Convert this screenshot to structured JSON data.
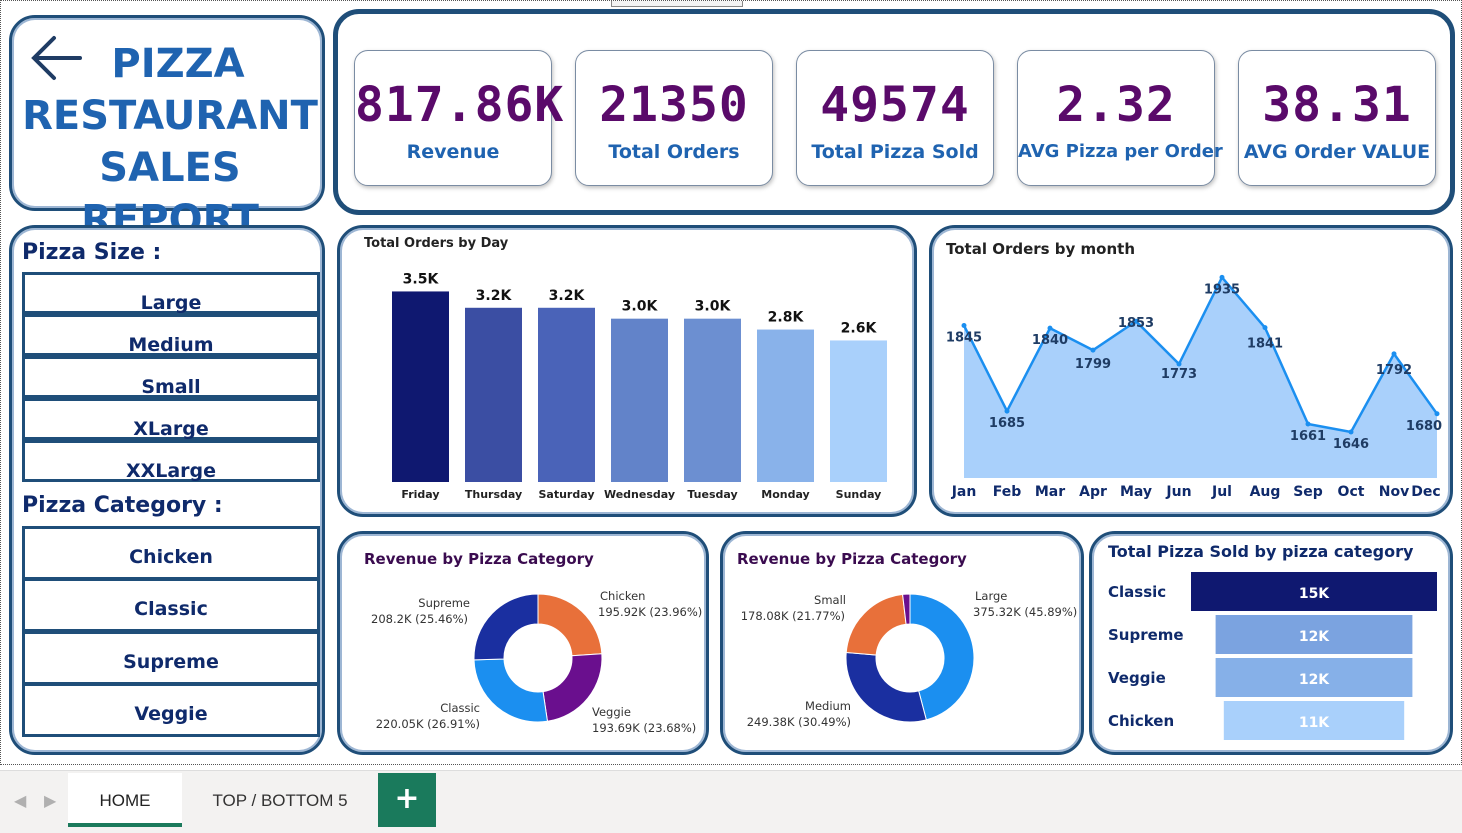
{
  "title": {
    "line1": "PIZZA",
    "line2": "RESTAURANT",
    "line3": "SALES REPORT"
  },
  "kpis": [
    {
      "value": "817.86K",
      "label": "Revenue"
    },
    {
      "value": "21350",
      "label": "Total Orders"
    },
    {
      "value": "49574",
      "label": "Total Pizza Sold"
    },
    {
      "value": "2.32",
      "label": "AVG Pizza per Order"
    },
    {
      "value": "38.31",
      "label": "AVG Order VALUE"
    }
  ],
  "filters": {
    "size_heading": "Pizza Size :",
    "sizes": [
      "Large",
      "Medium",
      "Small",
      "XLarge",
      "XXLarge"
    ],
    "category_heading": "Pizza Category :",
    "categories": [
      "Chicken",
      "Classic",
      "Supreme",
      "Veggie"
    ]
  },
  "colors": {
    "accent": "#1f4e79",
    "kpi_value": "#5a0a6a",
    "kpi_label": "#1f63b0",
    "tab_green": "#1a7a5c"
  },
  "chart_data": [
    {
      "id": "orders-by-day",
      "type": "bar",
      "title": "Total Orders by Day",
      "categories": [
        "Friday",
        "Thursday",
        "Saturday",
        "Wednesday",
        "Tuesday",
        "Monday",
        "Sunday"
      ],
      "values": [
        3500,
        3200,
        3200,
        3000,
        3000,
        2800,
        2600
      ],
      "data_labels": [
        "3.5K",
        "3.2K",
        "3.2K",
        "3.0K",
        "3.0K",
        "2.8K",
        "2.6K"
      ],
      "colors": [
        "#0f1870",
        "#3b4ea3",
        "#4a63b8",
        "#6283c9",
        "#6c8fd1",
        "#89b2ea",
        "#a9d0fb"
      ],
      "ylim": [
        0,
        3600
      ],
      "grid": false
    },
    {
      "id": "orders-by-month",
      "type": "area",
      "title": "Total Orders by month",
      "categories": [
        "Jan",
        "Feb",
        "Mar",
        "Apr",
        "May",
        "Jun",
        "Jul",
        "Aug",
        "Sep",
        "Oct",
        "Nov",
        "Dec"
      ],
      "values": [
        1845,
        1685,
        1840,
        1799,
        1853,
        1773,
        1935,
        1841,
        1661,
        1646,
        1792,
        1680
      ],
      "ylim": [
        1560,
        1945
      ],
      "grid": false
    },
    {
      "id": "revenue-by-category",
      "type": "pie",
      "title": "Revenue by Pizza Category",
      "slices": [
        {
          "name": "Chicken",
          "value": 195.92,
          "label": "195.92K (23.96%)",
          "color": "#e8703a"
        },
        {
          "name": "Veggie",
          "value": 193.69,
          "label": "193.69K (23.68%)",
          "color": "#6a0f8e"
        },
        {
          "name": "Classic",
          "value": 220.05,
          "label": "220.05K (26.91%)",
          "color": "#1b8ff0"
        },
        {
          "name": "Supreme",
          "value": 208.2,
          "label": "208.2K (25.46%)",
          "color": "#1a2fa0"
        }
      ]
    },
    {
      "id": "revenue-by-size",
      "type": "pie",
      "title": "Revenue by Pizza Category",
      "slices": [
        {
          "name": "Large",
          "value": 375.32,
          "label": "375.32K (45.89%)",
          "color": "#1b8ff0"
        },
        {
          "name": "Medium",
          "value": 249.38,
          "label": "249.38K (30.49%)",
          "color": "#1a2fa0"
        },
        {
          "name": "Small",
          "value": 178.08,
          "label": "178.08K (21.77%)",
          "color": "#e8703a"
        },
        {
          "name": "",
          "value": 15.08,
          "label": "",
          "color": "#6a0f8e"
        }
      ]
    },
    {
      "id": "pizza-sold-by-category",
      "type": "bar",
      "orientation": "horizontal-funnel",
      "title": "Total Pizza Sold by pizza category",
      "categories": [
        "Classic",
        "Supreme",
        "Veggie",
        "Chicken"
      ],
      "values": [
        15000,
        12000,
        12000,
        11000
      ],
      "data_labels": [
        "15K",
        "12K",
        "12K",
        "11K"
      ],
      "colors": [
        "#0f1870",
        "#7ba3e0",
        "#86b0e8",
        "#a9d0fb"
      ]
    }
  ],
  "page_tabs": [
    {
      "label": "HOME",
      "active": true
    },
    {
      "label": "TOP / BOTTOM 5",
      "active": false
    }
  ],
  "add_tab_label": "+",
  "nav": {
    "prev": "◀",
    "next": "▶"
  }
}
